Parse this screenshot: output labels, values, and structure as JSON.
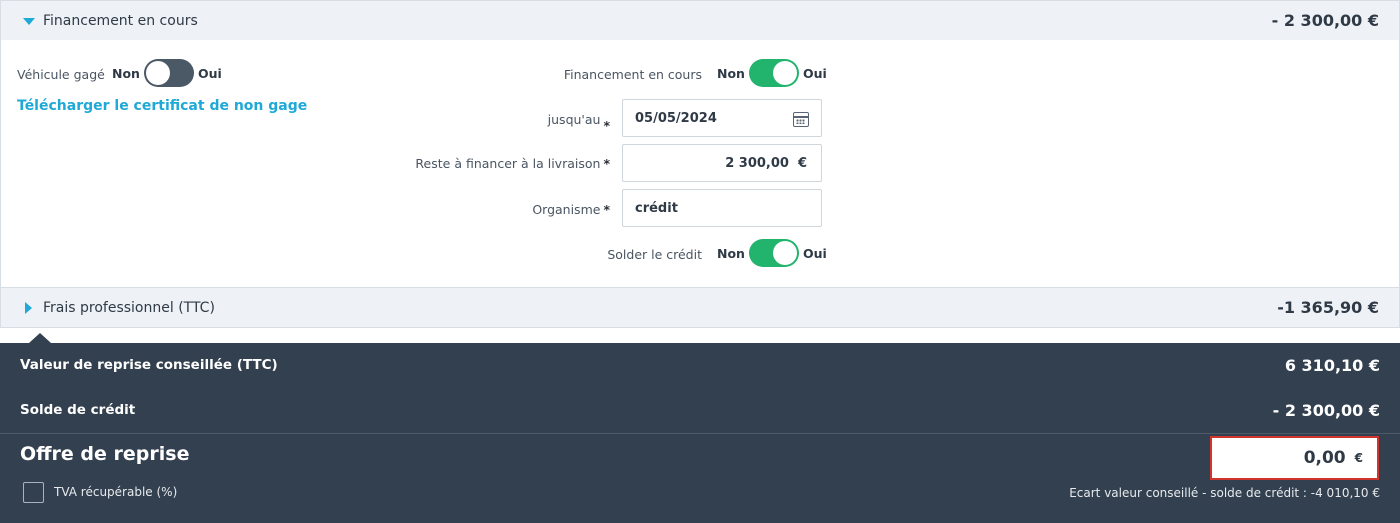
{
  "financement": {
    "title": "Financement en cours",
    "amount": "- 2 300,00 €",
    "vehicule_gage": {
      "label": "Véhicule gagé",
      "no": "Non",
      "yes": "Oui",
      "state": "off"
    },
    "download_link": "Télécharger le certificat de non gage",
    "financement_toggle": {
      "label": "Financement en cours",
      "no": "Non",
      "yes": "Oui",
      "state": "on"
    },
    "jusquau": {
      "label": "jusqu'au",
      "required": "*",
      "value": "05/05/2024",
      "icon": "calendar-icon"
    },
    "reste": {
      "label": "Reste à financer à la livraison",
      "required": "*",
      "value": "2 300,00",
      "currency": "€"
    },
    "organisme": {
      "label": "Organisme",
      "required": "*",
      "value": "crédit"
    },
    "solder": {
      "label": "Solder le crédit",
      "no": "Non",
      "yes": "Oui",
      "state": "on"
    }
  },
  "frais": {
    "title": "Frais professionnel (TTC)",
    "amount": "-1 365,90 €"
  },
  "summary": {
    "valeur_label": "Valeur de reprise conseillée (TTC)",
    "valeur_amount": "6 310,10 €",
    "solde_label": "Solde de crédit",
    "solde_amount": "- 2 300,00 €",
    "offre_title": "Offre de reprise",
    "offre_value": "0,00",
    "offre_currency": "€",
    "tva_label": "TVA récupérable (%)",
    "ecart_text": "Ecart valeur conseillé - solde de crédit : -4 010,10 €"
  },
  "colors": {
    "accent": "#1fa9d6",
    "toggle_on": "#22b36c",
    "toggle_off": "#4b5866",
    "dark_panel": "#33404f",
    "error_border": "#d0342c"
  }
}
